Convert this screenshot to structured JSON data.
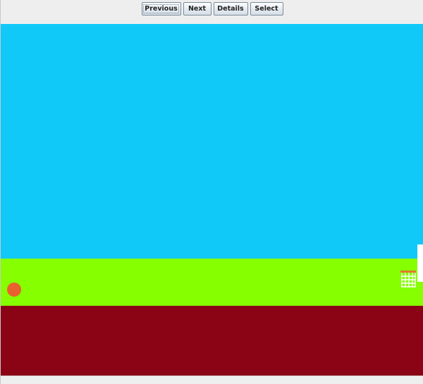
{
  "toolbar": {
    "previous_label": "Previous",
    "next_label": "Next",
    "details_label": "Details",
    "select_label": "Select"
  },
  "scene": {
    "sky_color": "#11c9f8",
    "grass_color": "#86ff00",
    "soil_color": "#8a0415",
    "ball_color": "#ea6130",
    "rim_color": "#e07a2a",
    "net_color": "#ffffff",
    "icons": [
      "ball-icon",
      "basketball-hoop-icon",
      "backboard-icon"
    ]
  }
}
